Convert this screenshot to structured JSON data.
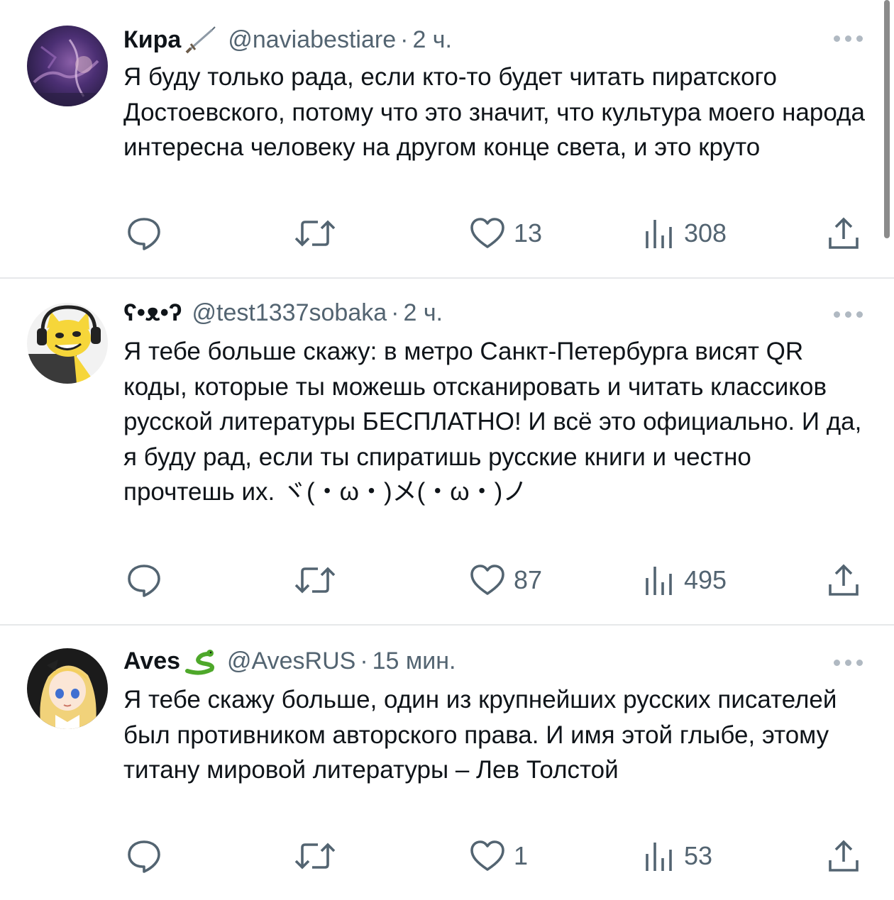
{
  "tweets": [
    {
      "name": "Кира",
      "name_emoji": "sword-icon",
      "handle": "@naviabestiare",
      "separator": "·",
      "time": "2 ч.",
      "text": "Я буду только рада, если кто-то будет читать пиратского Достоевского, потому что это значит, что культура моего народа интересна человеку на другом конце света, и это круто",
      "replies": "",
      "reposts": "",
      "likes": "13",
      "views": "308",
      "avatar_icon": "avatar-dark-purple-photo"
    },
    {
      "name": "ʕ•ᴥ•ʔ",
      "name_emoji": "",
      "handle": "@test1337sobaka",
      "separator": "·",
      "time": "2 ч.",
      "text": "Я тебе больше скажу: в метро Санкт-Петербурга висят QR коды, которые ты можешь отсканировать и читать классиков русской литературы БЕСПЛАТНО! И всё это официально. И да, я буду рад, если ты спиратишь русские книги и честно прочтешь их. ヾ(・ω・)メ(・ω・)ノ",
      "replies": "",
      "reposts": "",
      "likes": "87",
      "views": "495",
      "avatar_icon": "avatar-yellow-cat-headphones"
    },
    {
      "name": "Aves",
      "name_emoji": "snake-icon",
      "handle": "@AvesRUS",
      "separator": "·",
      "time": "15 мин.",
      "text": "Я тебе скажу больше, один из крупнейших русских писателей был противником авторского права. И имя этой глыбе, этому титану мировой литературы – Лев Толстой",
      "replies": "",
      "reposts": "",
      "likes": "1",
      "views": "53",
      "avatar_icon": "avatar-anime-blonde-girl"
    }
  ],
  "icons": {
    "reply": "reply-bubble-icon",
    "repost": "repost-arrows-icon",
    "like": "heart-icon",
    "views": "views-bars-icon",
    "share": "share-upload-icon",
    "more": "more-dots-icon"
  },
  "colors": {
    "text": "#0f1419",
    "secondary": "#536471",
    "divider": "#e6e8ea",
    "background": "#ffffff"
  }
}
